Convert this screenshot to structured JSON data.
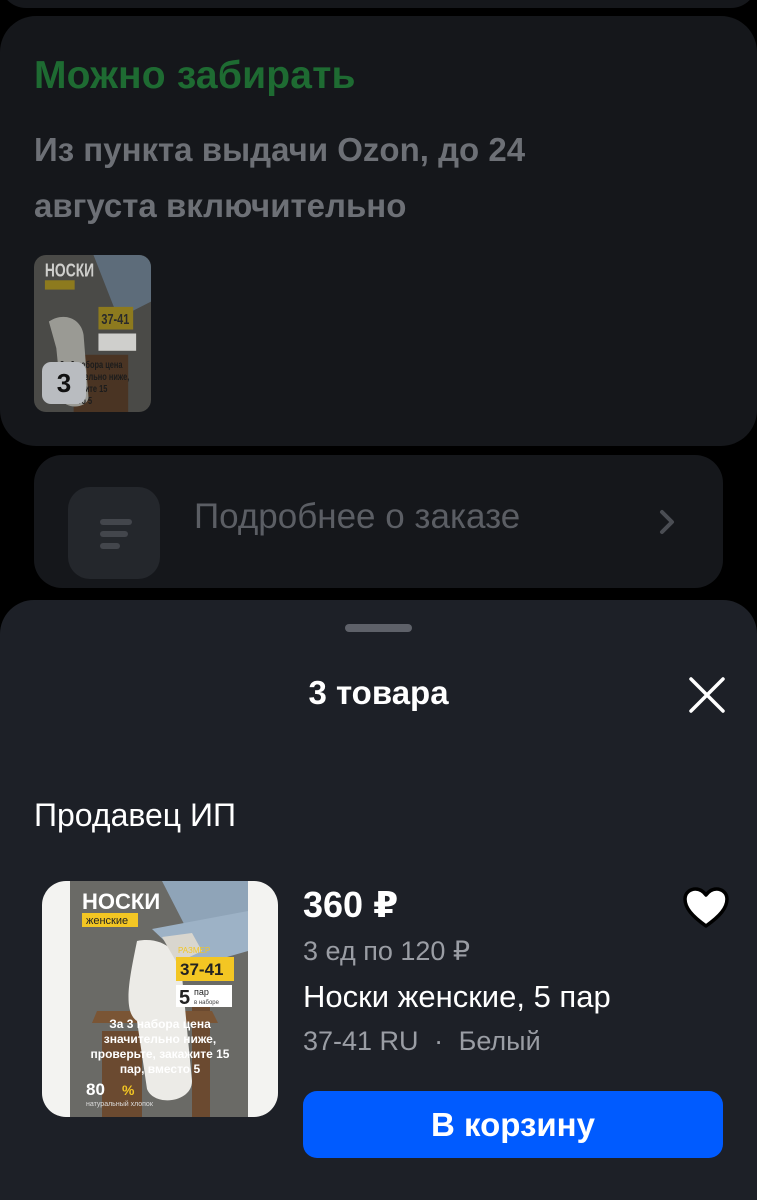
{
  "pickup": {
    "title": "Можно забирать",
    "subtitle": "Из пункта выдачи Ozon, до 24 августа включительно",
    "thumbnail_count": "3"
  },
  "details": {
    "label": "Подробнее о заказе"
  },
  "sheet": {
    "title": "3 товара",
    "seller": "Продавец ИП",
    "product": {
      "price": "360 ₽",
      "unit_price": "3 ед по 120 ₽",
      "name": "Носки женские, 5 пар",
      "size": "37-41 RU",
      "separator": "·",
      "color": "Белый",
      "image_text": {
        "brand": "НОСКИ",
        "subtitle": "женские",
        "size_caption": "РАЗМЕР",
        "size": "37-41",
        "pairs_num": "5",
        "pairs_word": "пар",
        "pairs_note": "в наборе",
        "offer": "За 3 набора цена значительно ниже, проверьте, закажите 15 пар, вместо 5",
        "percent": "80",
        "percent_sign": "%",
        "material": "натуральный хлопок"
      }
    },
    "add_to_cart": "В корзину"
  },
  "colors": {
    "accent_blue": "#005bff",
    "green_dim": "#1e6b32",
    "sheet_bg": "#1d2027"
  },
  "icons": {
    "close": "close-icon",
    "favorite": "heart-icon",
    "details": "list-icon",
    "chevron": "chevron-right-icon"
  }
}
